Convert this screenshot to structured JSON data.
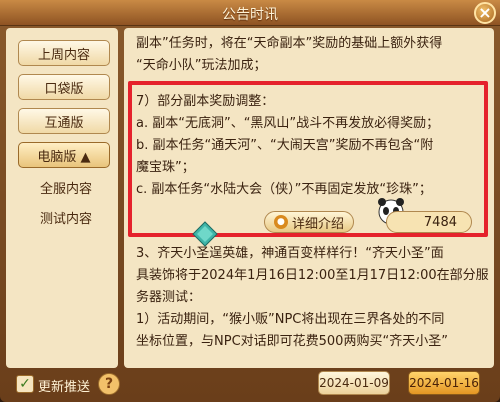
{
  "window": {
    "title": "公告时讯",
    "close_label": "×"
  },
  "sidebar": {
    "items": [
      {
        "label": "上周内容"
      },
      {
        "label": "口袋版"
      },
      {
        "label": "互通版"
      },
      {
        "label": "电脑版 ▲",
        "active": true
      }
    ],
    "subitems": [
      {
        "label": "全服内容"
      },
      {
        "label": "测试内容"
      }
    ]
  },
  "content": {
    "lines": [
      "副本”任务时，将在“天命副本”奖励的基础上额外获得",
      "“天命小队”玩法加成；",
      "7）部分副本奖励调整：",
      "a. 副本“无底洞”、“黑风山”战斗不再发放必得奖励；",
      "b. 副本任务“通天河”、“大闹天宫”奖励不再包含“附",
      "魔宝珠”；",
      "c. 副本任务“水陆大会（侠）”不再固定发放“珍珠”；",
      "3、齐天小圣逞英雄，神通百变样样行！“齐天小圣”面",
      "具装饰将于2024年1月16日12:00至1月17日12:00在部分服",
      "务器测试：",
      "1）活动期间，“猴小贩”NPC将出现在三界各处的不同",
      "坐标位置，与NPC对话即可花费500两购买“齐天小圣”"
    ],
    "detail_button": "详细介绍",
    "like_count": "7484"
  },
  "footer": {
    "auto_push_label": "更新推送",
    "auto_push_checked": true,
    "help_label": "?",
    "dates": [
      {
        "label": "2024-01-09",
        "active": false
      },
      {
        "label": "2024-01-16",
        "active": true
      }
    ]
  }
}
